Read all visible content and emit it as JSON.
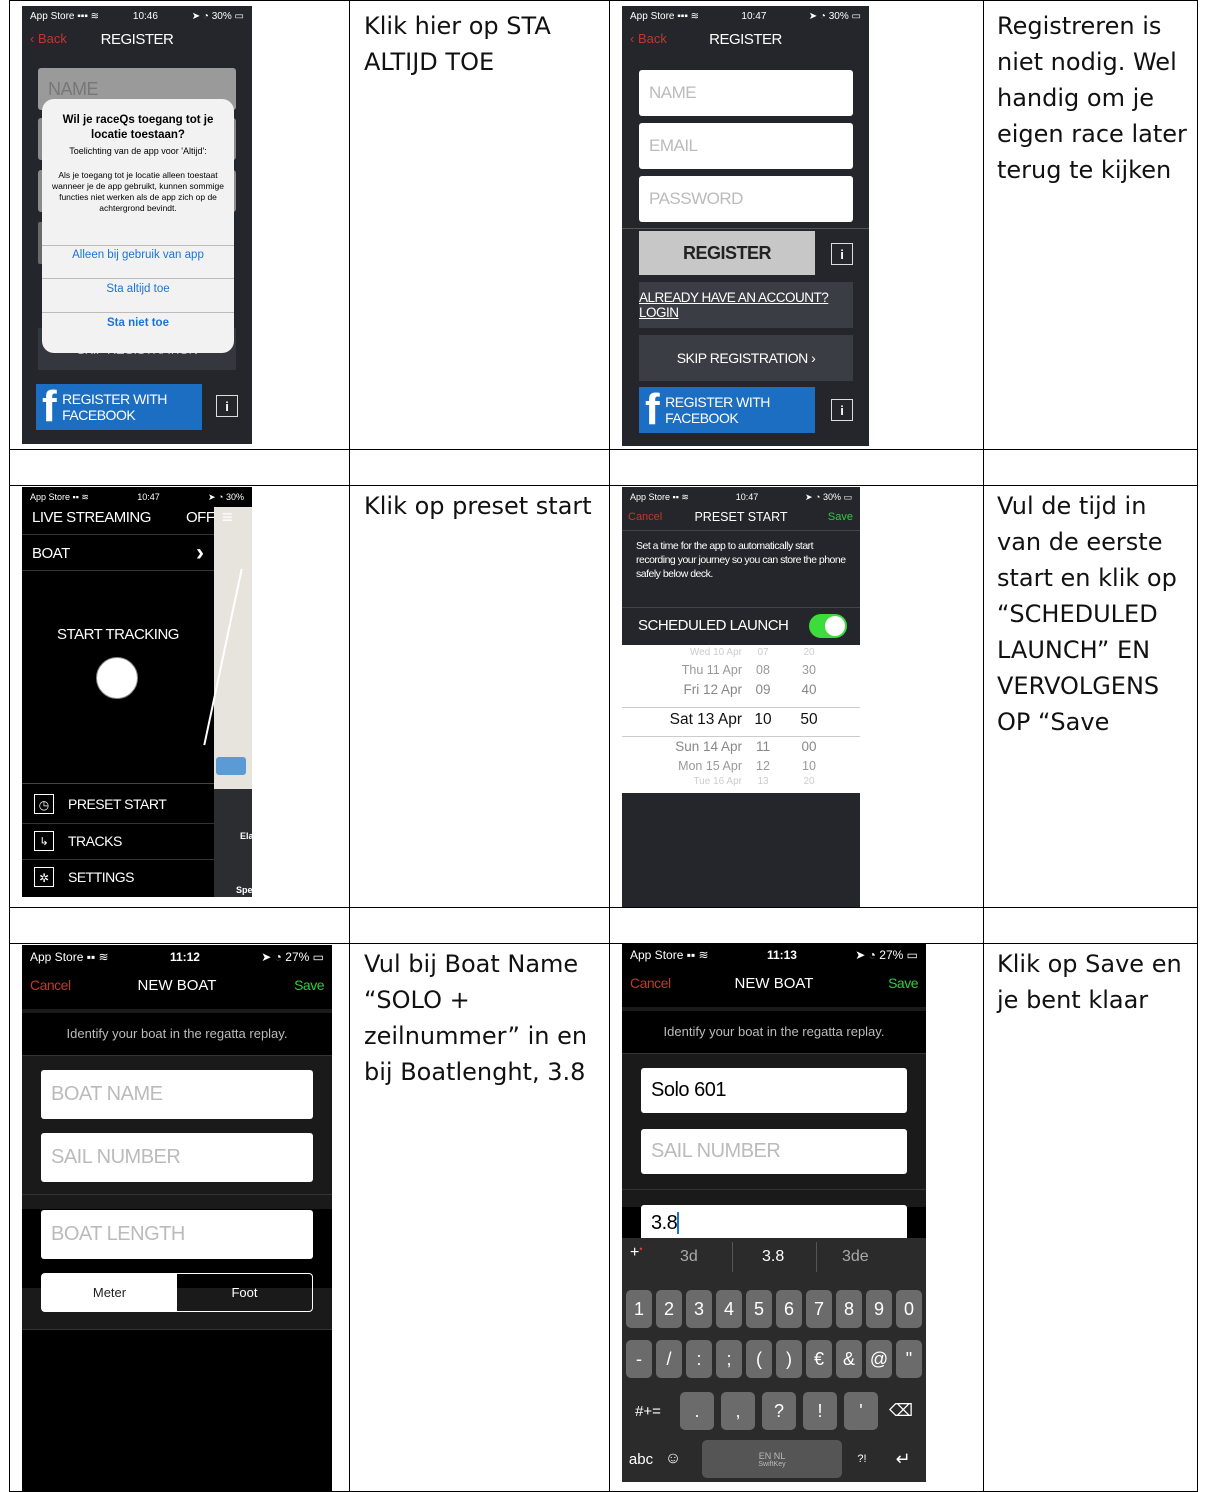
{
  "notes": {
    "r1c2": "Klik hier op STA ALTIJD TOE",
    "r1c4": "Registreren is niet nodig. Wel handig om je eigen race later terug te kijken",
    "r3c2": "Klik op preset start",
    "r3c4": "Vul de tijd in van de eerste start en klik op “SCHEDULED LAUNCH” EN VERVOLGENS OP “Save",
    "r5c2": "Vul bij Boat Name “SOLO + zeilnummer” in en bij Boatlenght, 3.8",
    "r5c4": "Klik op Save en je bent klaar"
  },
  "status": {
    "carrier": "App Store",
    "time1": "10:46",
    "time2": "10:47",
    "time3": "10:47",
    "time4": "10:47",
    "time5": "11:12",
    "time6": "11:13",
    "battery1": "30%",
    "battery5": "27%"
  },
  "phone1": {
    "back": "Back",
    "title": "REGISTER",
    "name_field": "NAME",
    "alert_title": "Wil je raceQs toegang tot je locatie toestaan?",
    "alert_sub": "Toelichting van de app voor 'Altijd':",
    "alert_body": "Als je toegang tot je locatie alleen toestaat wanneer je de app gebruikt, kunnen sommige functies niet werken als de app zich op de achtergrond bevindt.",
    "opt1": "Alleen bij gebruik van app",
    "opt2": "Sta altijd toe",
    "opt3": "Sta niet toe",
    "skip": "SKIP REGISTRATION",
    "facebook": "REGISTER WITH FACEBOOK",
    "info": "i"
  },
  "phone2": {
    "back": "Back",
    "title": "REGISTER",
    "name_placeholder": "NAME",
    "email_placeholder": "EMAIL",
    "password_placeholder": "PASSWORD",
    "register": "REGISTER",
    "login": "ALREADY HAVE AN ACCOUNT? LOGIN",
    "skip": "SKIP REGISTRATION",
    "facebook": "REGISTER WITH FACEBOOK",
    "info": "i"
  },
  "phone3": {
    "live": "LIVE STREAMING",
    "off": "OFF",
    "boat": "BOAT",
    "start": "START TRACKING",
    "menu": [
      "PRESET START",
      "TRACKS",
      "SETTINGS"
    ],
    "map_label1": "Ela",
    "map_label2": "Spe"
  },
  "phone4": {
    "cancel": "Cancel",
    "title": "PRESET START",
    "save": "Save",
    "desc": "Set a time for the app to automatically start recording your journey so you can store the phone safely below deck.",
    "launch": "SCHEDULED LAUNCH",
    "rows": [
      [
        "Wed 10 Apr",
        "07",
        "20"
      ],
      [
        "Thu 11 Apr",
        "08",
        "30"
      ],
      [
        "Fri 12 Apr",
        "09",
        "40"
      ],
      [
        "Sat 13 Apr",
        "10",
        "50"
      ],
      [
        "Sun 14 Apr",
        "11",
        "00"
      ],
      [
        "Mon 15 Apr",
        "12",
        "10"
      ],
      [
        "Tue 16 Apr",
        "13",
        "20"
      ]
    ]
  },
  "phone5": {
    "cancel": "Cancel",
    "title": "NEW BOAT",
    "save": "Save",
    "subtitle": "Identify your boat in the regatta replay.",
    "boat_name": "BOAT NAME",
    "sail_number": "SAIL NUMBER",
    "boat_length": "BOAT LENGTH",
    "meter": "Meter",
    "foot": "Foot"
  },
  "phone6": {
    "cancel": "Cancel",
    "title": "NEW BOAT",
    "save": "Save",
    "subtitle": "Identify your boat in the regatta replay.",
    "boat_name_value": "Solo 601",
    "sail_number": "SAIL NUMBER",
    "length_value": "3.8",
    "suggestions": [
      "3d",
      "3.8",
      "3de"
    ],
    "row1": [
      "1",
      "2",
      "3",
      "4",
      "5",
      "6",
      "7",
      "8",
      "9",
      "0"
    ],
    "row2": [
      "-",
      "/",
      ":",
      ";",
      "(",
      ")",
      "€",
      "&",
      "@",
      "\""
    ],
    "row3": [
      ".",
      ",",
      "?",
      "!",
      "'"
    ],
    "symbols": "#+=",
    "abc": "abc",
    "space": "EN NL",
    "space_sub": "SwiftKey"
  }
}
